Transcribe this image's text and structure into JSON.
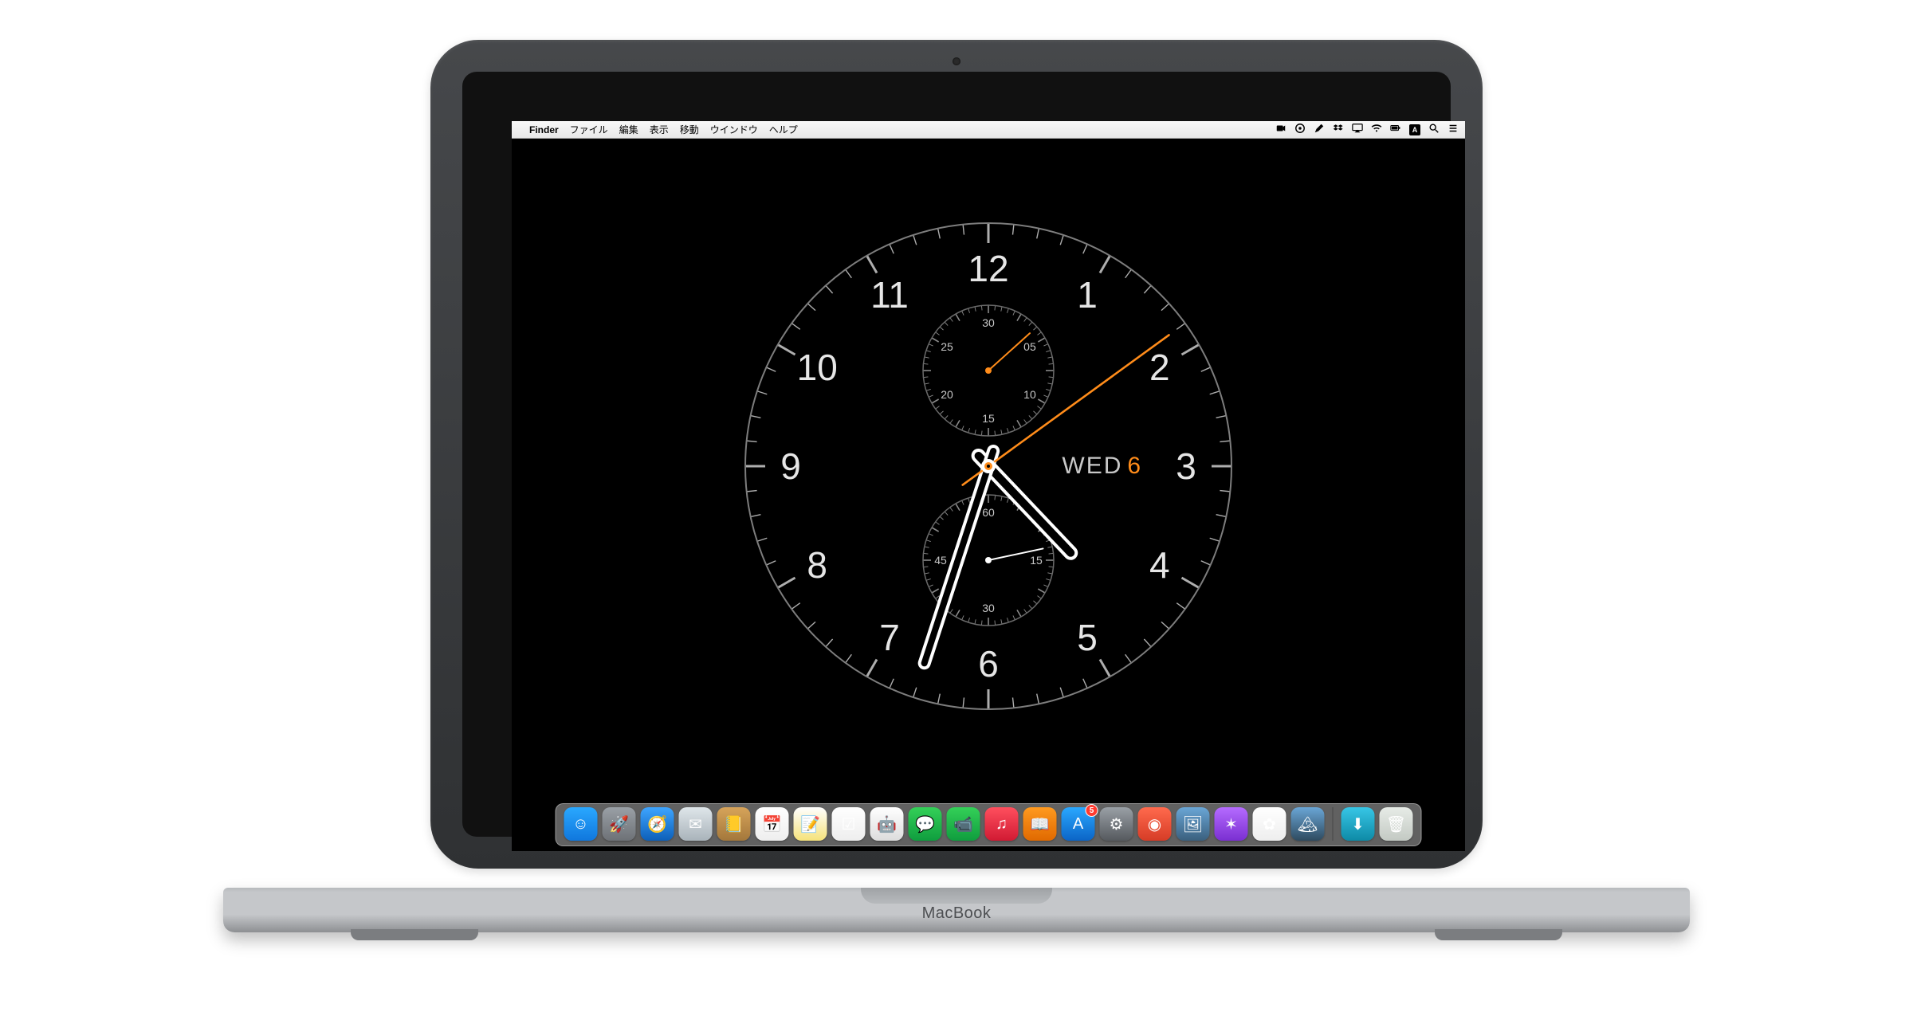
{
  "device": {
    "label": "MacBook"
  },
  "menubar": {
    "active_app": "Finder",
    "menus": [
      "ファイル",
      "編集",
      "表示",
      "移動",
      "ウインドウ",
      "ヘルプ"
    ],
    "status_icons": [
      "camera-icon",
      "circle-status-icon",
      "pen-icon",
      "dropbox-icon",
      "airplay-icon",
      "wifi-icon",
      "battery-icon"
    ],
    "ime_label": "A",
    "right_icons": [
      "spotlight-icon",
      "notification-center-icon"
    ]
  },
  "clock": {
    "hours": [
      "12",
      "1",
      "2",
      "3",
      "4",
      "5",
      "6",
      "7",
      "8",
      "9",
      "10",
      "11"
    ],
    "top_subdial_labels": [
      "30",
      "05",
      "10",
      "15",
      "20",
      "25"
    ],
    "bottom_subdial_labels": [
      "60",
      "15",
      "30",
      "45"
    ],
    "date_day": "WED",
    "date_num": "6",
    "time_hour": 4,
    "time_minute": 33,
    "time_second": 9,
    "top_sub_seconds": 8,
    "bottom_sub_seconds": 13,
    "accent": "#ff8c1a"
  },
  "dock": {
    "apps": [
      {
        "name": "finder",
        "bg1": "#2aa8ff",
        "bg2": "#1077dd",
        "glyph": "☺"
      },
      {
        "name": "launchpad",
        "bg1": "#9aa0a6",
        "bg2": "#6d7176",
        "glyph": "🚀"
      },
      {
        "name": "safari",
        "bg1": "#3ea5ff",
        "bg2": "#0d5fb8",
        "glyph": "🧭"
      },
      {
        "name": "mail",
        "bg1": "#dfe6ea",
        "bg2": "#a9b3ba",
        "glyph": "✉"
      },
      {
        "name": "contacts",
        "bg1": "#d7a45a",
        "bg2": "#a3773b",
        "glyph": "📒"
      },
      {
        "name": "calendar",
        "bg1": "#ffffff",
        "bg2": "#eeeeee",
        "glyph": "📅"
      },
      {
        "name": "notes",
        "bg1": "#ffffff",
        "bg2": "#f5e27a",
        "glyph": "📝"
      },
      {
        "name": "reminders",
        "bg1": "#ffffff",
        "bg2": "#eeeeee",
        "glyph": "☑"
      },
      {
        "name": "automator",
        "bg1": "#ffffff",
        "bg2": "#dcdcdc",
        "glyph": "🤖"
      },
      {
        "name": "messages",
        "bg1": "#34d058",
        "bg2": "#0f9d3e",
        "glyph": "💬"
      },
      {
        "name": "facetime",
        "bg1": "#34d058",
        "bg2": "#0f9d3e",
        "glyph": "📹"
      },
      {
        "name": "music",
        "bg1": "#ff4f5e",
        "bg2": "#d11a33",
        "glyph": "♫"
      },
      {
        "name": "books",
        "bg1": "#ff9a1f",
        "bg2": "#e06900",
        "glyph": "📖"
      },
      {
        "name": "appstore",
        "bg1": "#2aa8ff",
        "bg2": "#0b64c6",
        "glyph": "A",
        "badge": "5"
      },
      {
        "name": "system-prefs",
        "bg1": "#9aa0a6",
        "bg2": "#55595e",
        "glyph": "⚙"
      },
      {
        "name": "app-red",
        "bg1": "#ff6a4d",
        "bg2": "#d63c26",
        "glyph": "◉"
      },
      {
        "name": "preview",
        "bg1": "#6aa6d6",
        "bg2": "#3a5f7d",
        "glyph": "🖼"
      },
      {
        "name": "app-purple",
        "bg1": "#b56bff",
        "bg2": "#7a2fd1",
        "glyph": "✶"
      },
      {
        "name": "photos",
        "bg1": "#ffffff",
        "bg2": "#eeeeee",
        "glyph": "✿"
      },
      {
        "name": "wallpaper",
        "bg1": "#6aa6d6",
        "bg2": "#2e4a5f",
        "glyph": "🏔"
      }
    ],
    "right": [
      {
        "name": "downloads",
        "bg1": "#37c6e6",
        "bg2": "#0e8aa6",
        "glyph": "⬇"
      },
      {
        "name": "trash",
        "bg1": "#e7ece7",
        "bg2": "#c3c9c3",
        "glyph": "🗑"
      }
    ]
  }
}
